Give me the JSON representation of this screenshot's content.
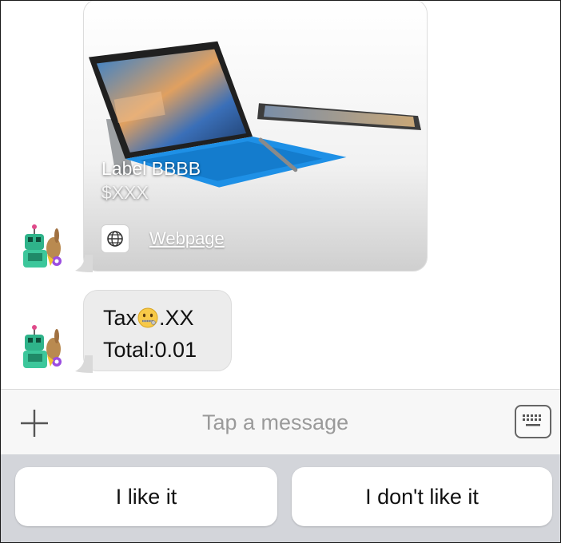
{
  "messages": {
    "card": {
      "title": "Label BBBB",
      "price": "$XXX",
      "link_label": "Webpage"
    },
    "text_bubble": {
      "line1_prefix": "Tax",
      "line1_suffix": ".XX",
      "line2": "Total:0.01"
    }
  },
  "input": {
    "placeholder": "Tap a message"
  },
  "quick_replies": [
    "I like it",
    "I don't like it"
  ],
  "colors": {
    "bubble_bg": "#ececec",
    "quick_reply_area": "#d3d5da",
    "placeholder_text": "#9a9a9a"
  },
  "icons": {
    "add": "plus-icon",
    "keyboard": "keyboard-icon",
    "web": "globe-icon",
    "emoji": "zipper-mouth-face-emoji"
  }
}
